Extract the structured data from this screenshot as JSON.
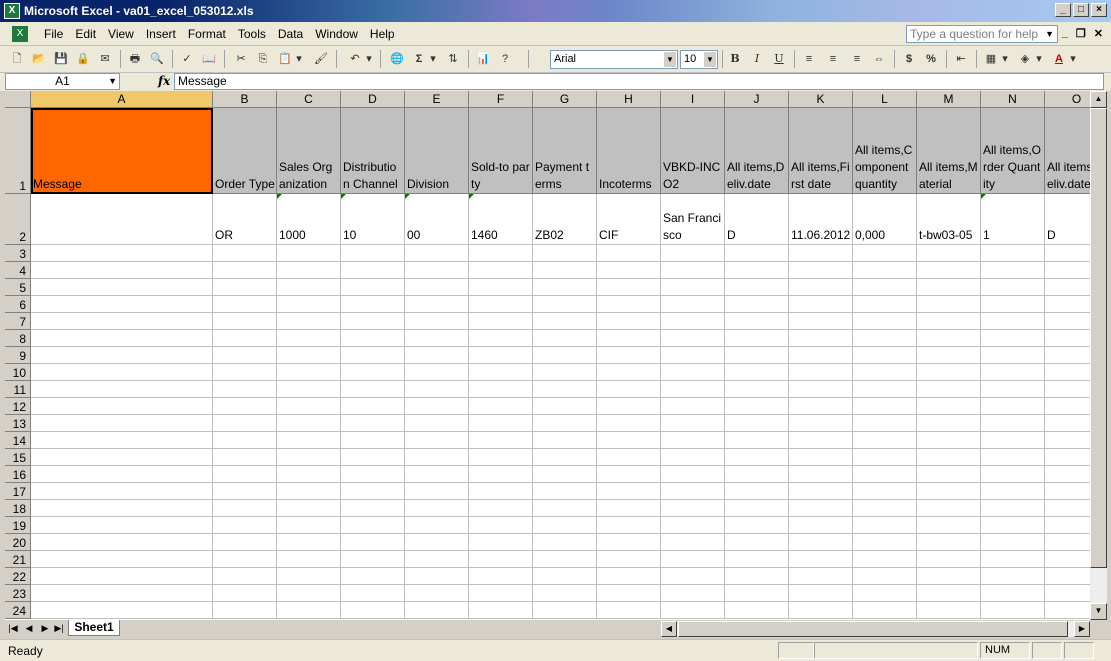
{
  "window": {
    "title": "Microsoft Excel - va01_excel_053012.xls",
    "app_icon": "excel-icon",
    "buttons": [
      "_",
      "□",
      "X"
    ]
  },
  "menubar": {
    "items": [
      "File",
      "Edit",
      "View",
      "Insert",
      "Format",
      "Tools",
      "Data",
      "Window",
      "Help"
    ],
    "help_placeholder": "Type a question for help",
    "doc_buttons": [
      "_",
      "▫",
      "X"
    ]
  },
  "toolbar": {
    "font_name": "Arial",
    "font_size": "10"
  },
  "formula_bar": {
    "name_box": "A1",
    "fx": "fx",
    "value": "Message"
  },
  "columns": [
    "A",
    "B",
    "C",
    "D",
    "E",
    "F",
    "G",
    "H",
    "I",
    "J",
    "K",
    "L",
    "M",
    "N",
    "O"
  ],
  "header_row": [
    "Message",
    "Order Type",
    "Sales Organization",
    "Distribution Channel",
    "Division",
    "Sold-to party",
    "Payment terms",
    "Incoterms",
    "VBKD-INCO2",
    "All items,Deliv.date",
    "All items,First date",
    "All items,Component quantity",
    "All items,Material",
    "All items,Order Quantity",
    "All items,Deliv.date"
  ],
  "data_row": [
    "",
    "OR",
    "1000",
    "10",
    "00",
    "1460",
    "ZB02",
    "CIF",
    "San Francisco",
    "D",
    "11.06.2012",
    "0,000",
    "t-bw03-05",
    "1",
    "D"
  ],
  "row_numbers": [
    "1",
    "2",
    "3",
    "4",
    "5",
    "6",
    "7",
    "8",
    "9",
    "10",
    "11",
    "12",
    "13",
    "14",
    "15",
    "16",
    "17",
    "18",
    "19",
    "20",
    "21",
    "22",
    "23",
    "24"
  ],
  "sheet_tabs": [
    "Sheet1"
  ],
  "status": {
    "text": "Ready",
    "num": "NUM"
  },
  "colors": {
    "message_header": "#ff6600",
    "header_fill": "#c0c0c0",
    "error_triangle": "#008000"
  }
}
